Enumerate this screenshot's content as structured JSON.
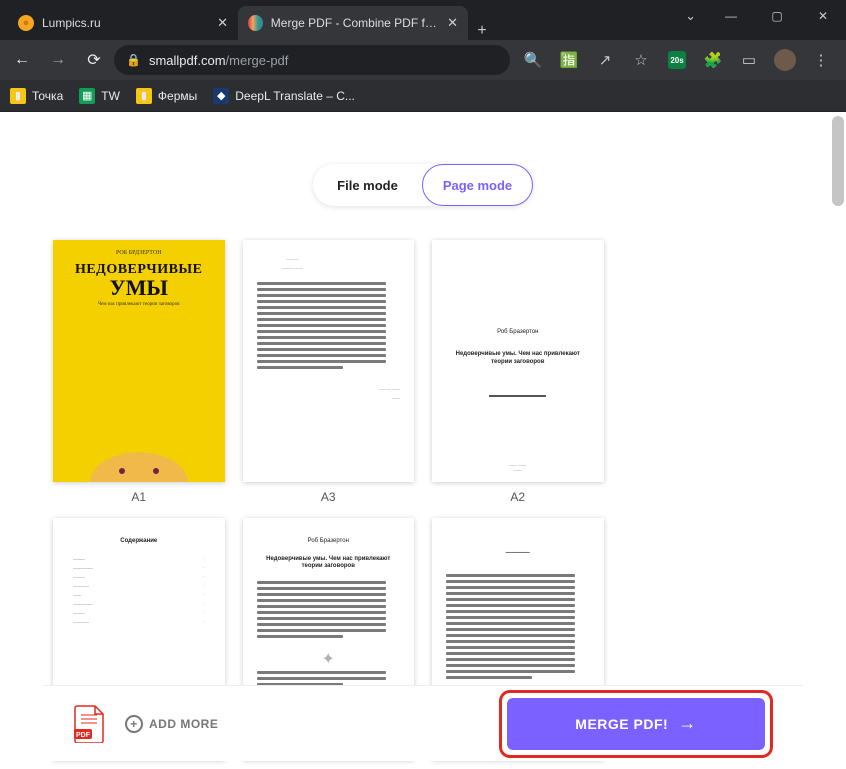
{
  "window": {
    "chevron": "⌄"
  },
  "tabs": [
    {
      "title": "Lumpics.ru",
      "favicon_bg": "#f5a623",
      "favicon_glyph": "●",
      "active": false
    },
    {
      "title": "Merge PDF - Combine PDF files o",
      "favicon_bg": "#00b4d8",
      "favicon_glyph": "◧",
      "active": true
    }
  ],
  "address": {
    "domain": "smallpdf.com",
    "path": "/merge-pdf",
    "ext_badge": "20s"
  },
  "bookmarks": [
    {
      "label": "Точка",
      "color": "#f5c518"
    },
    {
      "label": "TW",
      "color": "#0f9d58"
    },
    {
      "label": "Фермы",
      "color": "#f5c518"
    },
    {
      "label": "DeepL Translate – С...",
      "color": "#1a3a6e"
    }
  ],
  "mode": {
    "file": "File mode",
    "page": "Page mode",
    "active": "page"
  },
  "pages_row1": [
    {
      "label": "A1",
      "kind": "cover",
      "cover": {
        "author": "РОБ БРДЗЕРТОН",
        "line1": "НЕДОВЕРЧИВЫЕ",
        "line2": "УМЫ",
        "sub": "Чем нас привлекают теории заговоров"
      }
    },
    {
      "label": "A3",
      "kind": "text_block"
    },
    {
      "label": "A2",
      "kind": "title_page",
      "title": {
        "author": "Роб Бразертон",
        "line": "Недоверчивые умы. Чем нас привлекают теории заговоров"
      }
    }
  ],
  "pages_row2": [
    {
      "kind": "toc",
      "title": "Содержание"
    },
    {
      "kind": "text_titled",
      "title": {
        "author": "Роб Бразертон",
        "line": "Недоверчивые умы. Чем нас привлекают теории заговоров"
      }
    },
    {
      "kind": "text_simple"
    }
  ],
  "bottom": {
    "add_more": "ADD MORE",
    "merge": "MERGE PDF!"
  }
}
